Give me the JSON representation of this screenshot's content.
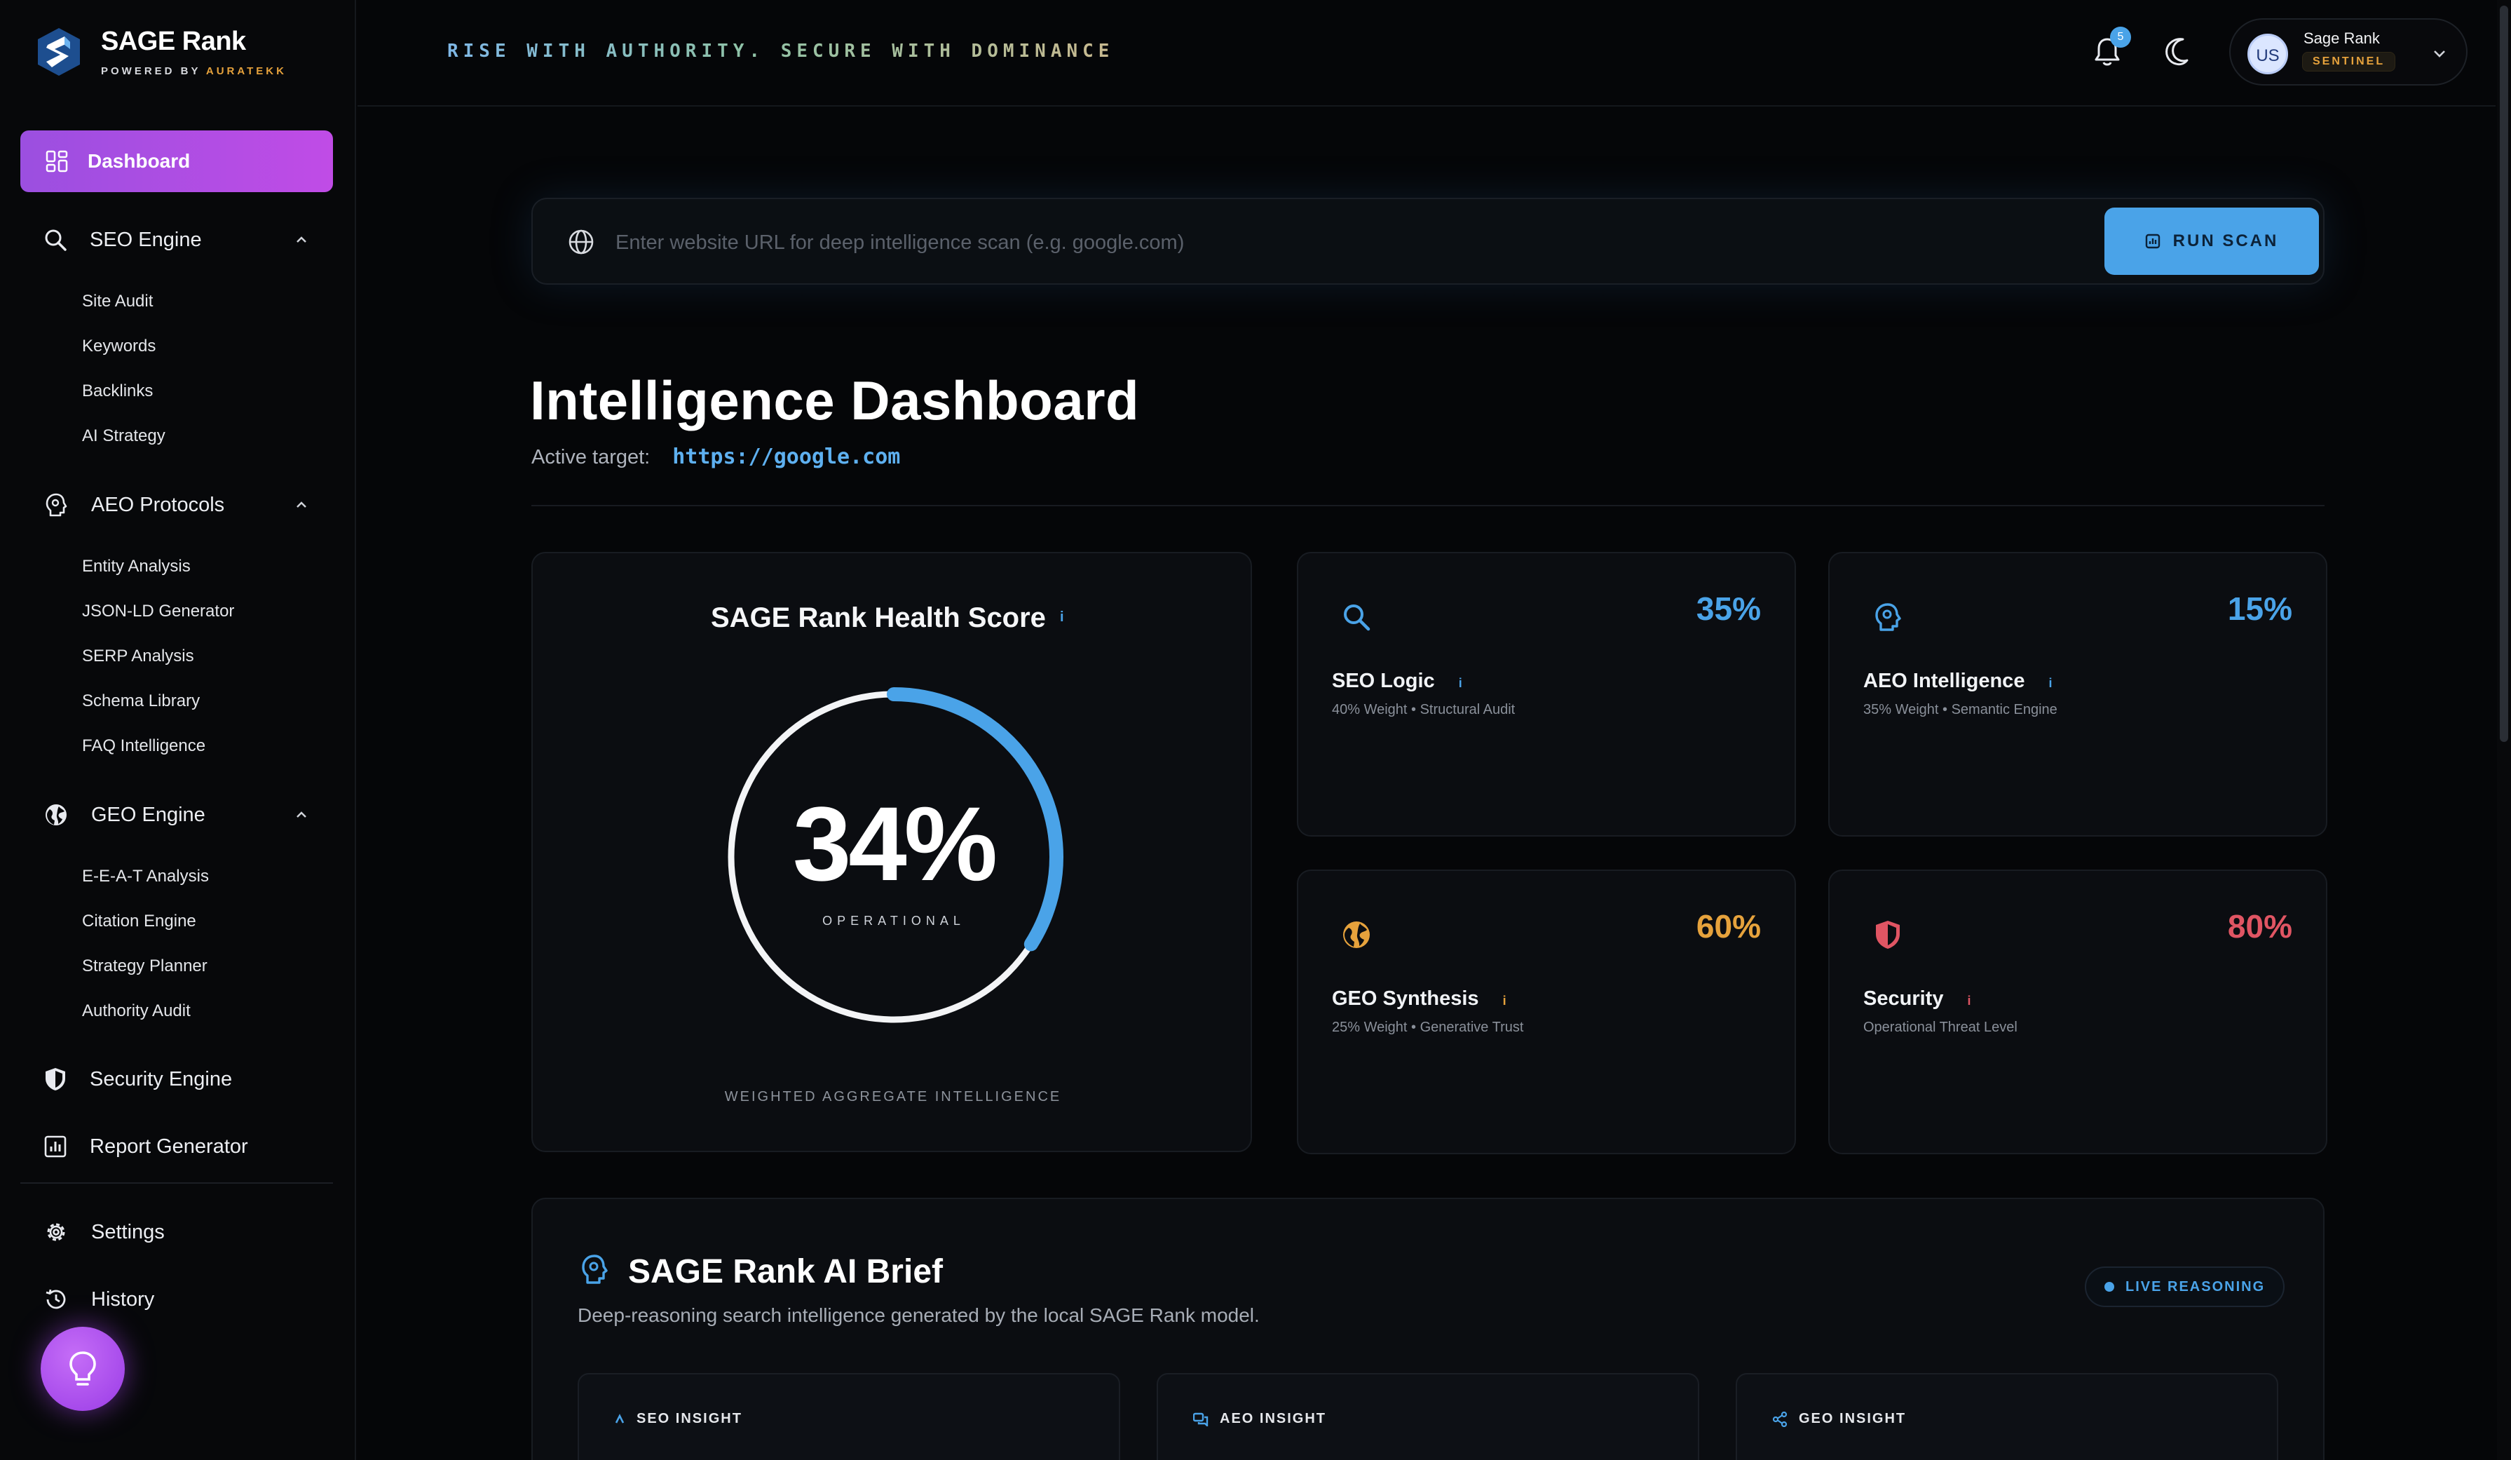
{
  "app": {
    "name": "SAGE Rank",
    "powered_prefix": "POWERED BY",
    "powered_brand": "AURATEKK"
  },
  "sidebar": {
    "dashboard": "Dashboard",
    "seo_engine": {
      "label": "SEO Engine",
      "items": [
        "Site Audit",
        "Keywords",
        "Backlinks",
        "AI Strategy"
      ]
    },
    "aeo_protocols": {
      "label": "AEO Protocols",
      "items": [
        "Entity Analysis",
        "JSON-LD Generator",
        "SERP Analysis",
        "Schema Library",
        "FAQ Intelligence"
      ]
    },
    "geo_engine": {
      "label": "GEO Engine",
      "items": [
        "E-E-A-T Analysis",
        "Citation Engine",
        "Strategy Planner",
        "Authority Audit"
      ]
    },
    "security_engine": "Security Engine",
    "report_generator": "Report Generator",
    "settings": "Settings",
    "history": "History"
  },
  "topbar": {
    "tagline": "RISE WITH AUTHORITY. SECURE WITH DOMINANCE",
    "notification_count": "5",
    "user": {
      "initials": "US",
      "name": "Sage Rank",
      "role": "SENTINEL"
    }
  },
  "search": {
    "placeholder": "Enter website URL for deep intelligence scan (e.g. google.com)",
    "value": "",
    "button": "RUN SCAN"
  },
  "dashboard": {
    "title": "Intelligence Dashboard",
    "target_label": "Active target:",
    "target_url": "https://google.com"
  },
  "health": {
    "title": "SAGE Rank Health Score",
    "info": "i",
    "value": "34%",
    "fraction": 0.34,
    "status": "OPERATIONAL",
    "footer": "WEIGHTED AGGREGATE INTELLIGENCE"
  },
  "metrics": {
    "seo": {
      "name": "SEO Logic",
      "info": "i",
      "pct": "35%",
      "sub": "40% Weight • Structural Audit",
      "icon": "search-icon",
      "color": "#4aa3e8"
    },
    "aeo": {
      "name": "AEO Intelligence",
      "info": "i",
      "pct": "15%",
      "sub": "35% Weight • Semantic Engine",
      "icon": "brain-icon",
      "color": "#4aa3e8"
    },
    "geo": {
      "name": "GEO Synthesis",
      "info": "i",
      "pct": "60%",
      "sub": "25% Weight • Generative Trust",
      "icon": "globe-icon",
      "color": "#e6a23c"
    },
    "security": {
      "name": "Security",
      "info": "i",
      "pct": "80%",
      "sub": "Operational Threat Level",
      "icon": "shield-icon",
      "color": "#e05563"
    }
  },
  "brief": {
    "title": "SAGE Rank AI Brief",
    "subtitle": "Deep-reasoning search intelligence generated by the local SAGE Rank model.",
    "live": "LIVE REASONING",
    "insights": [
      "SEO INSIGHT",
      "AEO INSIGHT",
      "GEO INSIGHT"
    ]
  },
  "colors": {
    "accent": "#4aa3e8",
    "sidebar_active": "#b04ee4",
    "warning": "#e6a23c",
    "danger": "#e05563"
  }
}
